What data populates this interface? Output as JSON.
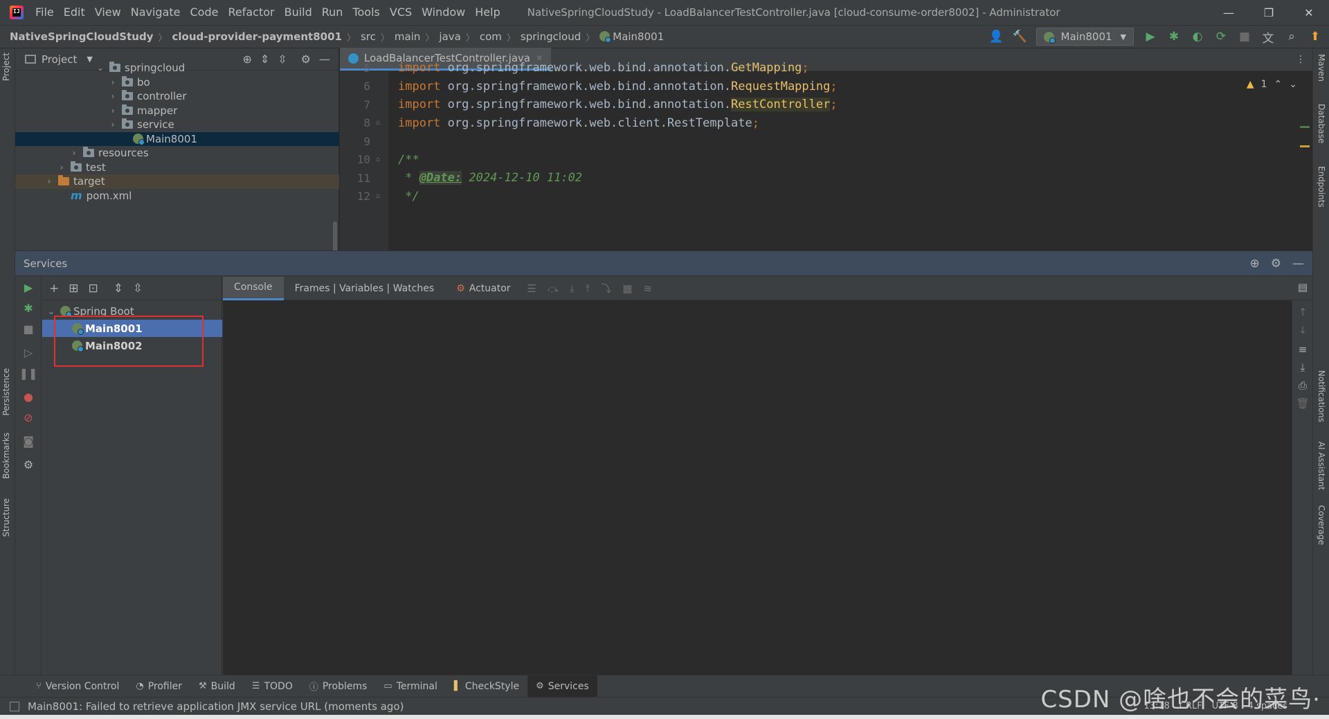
{
  "app": {
    "logo_text": "IJ",
    "window_title": "NativeSpringCloudStudy - LoadBalancerTestController.java [cloud-consume-order8002] - Administrator"
  },
  "menu": [
    "File",
    "Edit",
    "View",
    "Navigate",
    "Code",
    "Refactor",
    "Build",
    "Run",
    "Tools",
    "VCS",
    "Window",
    "Help"
  ],
  "breadcrumb": [
    "NativeSpringCloudStudy",
    "cloud-provider-payment8001",
    "src",
    "main",
    "java",
    "com",
    "springcloud",
    "Main8001"
  ],
  "run_config": "Main8001",
  "left_tabs": [
    "Project",
    "Persistence",
    "Bookmarks",
    "Structure"
  ],
  "right_tabs": [
    "Maven",
    "Database",
    "Endpoints",
    "Notifications",
    "AI Assistant",
    "Coverage"
  ],
  "project": {
    "title": "Project",
    "tree": [
      {
        "label": "springcloud",
        "chev": "⌄",
        "kind": "folder"
      },
      {
        "label": "bo",
        "chev": "›",
        "kind": "folder"
      },
      {
        "label": "controller",
        "chev": "›",
        "kind": "folder"
      },
      {
        "label": "mapper",
        "chev": "›",
        "kind": "folder"
      },
      {
        "label": "service",
        "chev": "›",
        "kind": "folder"
      },
      {
        "label": "Main8001",
        "chev": "",
        "kind": "spring"
      },
      {
        "label": "resources",
        "chev": "›",
        "kind": "folder"
      },
      {
        "label": "test",
        "chev": "›",
        "kind": "folder"
      },
      {
        "label": "target",
        "chev": "›",
        "kind": "folder-orange"
      },
      {
        "label": "pom.xml",
        "chev": "",
        "kind": "maven"
      }
    ]
  },
  "editor": {
    "tab": "LoadBalancerTestController.java",
    "warning_count": "1",
    "lines": [
      {
        "n": "5",
        "kw": "import",
        "pkg": " org.springframework.web.bind.annotation.",
        "cls": "GetMapping",
        "semi": ";"
      },
      {
        "n": "6",
        "kw": "import",
        "pkg": " org.springframework.web.bind.annotation.",
        "cls": "RequestMapping",
        "semi": ";"
      },
      {
        "n": "7",
        "kw": "import",
        "pkg": " org.springframework.web.bind.annotation.",
        "cls": "RestController",
        "semi": ";"
      },
      {
        "n": "8",
        "kw": "import",
        "pkg": " org.springframework.web.client.RestTemplate",
        "cls": "",
        "semi": ";"
      },
      {
        "n": "9"
      },
      {
        "n": "10",
        "comment": "/**"
      },
      {
        "n": "11",
        "comment_pre": " * ",
        "tag": "@Date:",
        "comment": " 2024-12-10 11:02"
      },
      {
        "n": "12",
        "comment": " */"
      }
    ]
  },
  "services": {
    "title": "Services",
    "tree_group": "Spring Boot",
    "apps": [
      "Main8001",
      "Main8002"
    ],
    "tabs": [
      "Console",
      "Frames | Variables | Watches",
      "Actuator"
    ]
  },
  "bottom_tabs": [
    {
      "label": "Version Control",
      "icon": "branch-icon"
    },
    {
      "label": "Profiler",
      "icon": "profiler-icon"
    },
    {
      "label": "Build",
      "icon": "hammer-icon"
    },
    {
      "label": "TODO",
      "icon": "list-icon"
    },
    {
      "label": "Problems",
      "icon": "info-icon"
    },
    {
      "label": "Terminal",
      "icon": "terminal-icon"
    },
    {
      "label": "CheckStyle",
      "icon": "checkstyle-icon"
    },
    {
      "label": "Services",
      "icon": "services-icon"
    }
  ],
  "status": {
    "message": "Main8001: Failed to retrieve application JMX service URL (moments ago)",
    "position": "13:18",
    "line_sep": "CRLF",
    "encoding": "UTF-8",
    "indent": "4 spaces"
  },
  "watermark": "CSDN @啥也不会的菜鸟·"
}
